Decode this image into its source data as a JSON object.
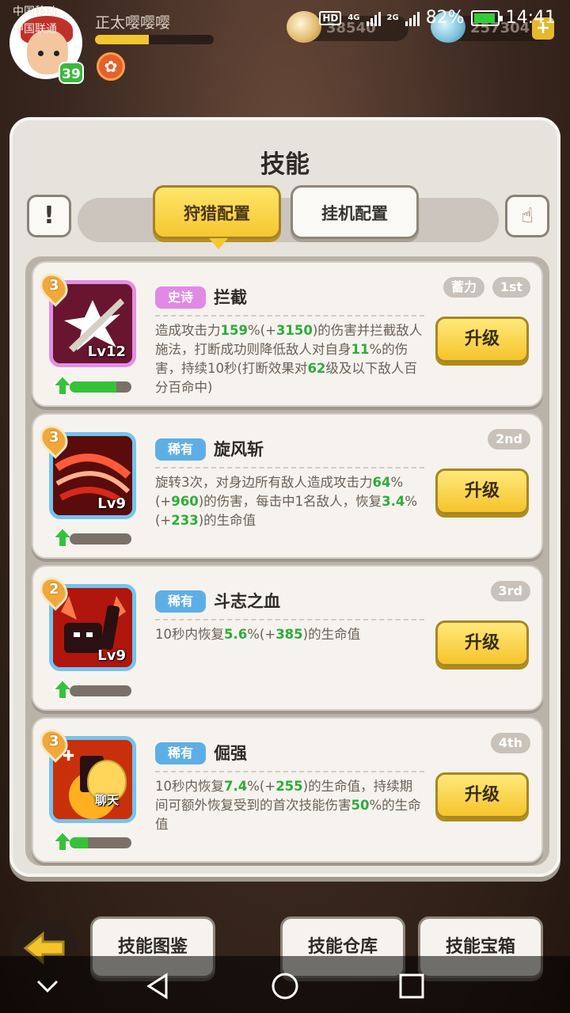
{
  "status_bar": {
    "carrier_1": "中国移动",
    "carrier_2": "中国联通",
    "hd": "HD",
    "net_1": "4G",
    "net_2": "2G",
    "battery": "82%",
    "time": "14:41"
  },
  "player": {
    "name": "正太嘤嘤嘤",
    "level": "39",
    "xp_fraction": 0.45,
    "avatar_icon": "hero-avatar-icon",
    "guild_icon": "guild-emblem-icon"
  },
  "resources": {
    "gold": "38540",
    "stamina": "257304",
    "plus": "+"
  },
  "panel": {
    "title": "技能",
    "info": "!",
    "tabs": [
      "狩猎配置",
      "挂机配置"
    ],
    "active_tab": 0
  },
  "skills": [
    {
      "tier": "3",
      "lv": "Lv12",
      "rarity": "史诗",
      "rarity_type": "epic",
      "name": "拦截",
      "charge": "蓄力",
      "rank": "1st",
      "progress": 0.75,
      "upgrade": "升级",
      "desc": [
        {
          "t": "造成攻击力"
        },
        {
          "t": "159",
          "g": true
        },
        {
          "t": "%(+"
        },
        {
          "t": "3150",
          "g": true
        },
        {
          "t": ")的伤害并拦截敌人施法，打断成功则降低敌人对自身"
        },
        {
          "t": "11",
          "g": true
        },
        {
          "t": "%的伤害，持续10秒(打断效果对"
        },
        {
          "t": "62",
          "g": true
        },
        {
          "t": "级及以下敌人百分百命中)"
        }
      ]
    },
    {
      "tier": "3",
      "lv": "Lv9",
      "rarity": "稀有",
      "rarity_type": "rare",
      "name": "旋风斩",
      "rank": "2nd",
      "progress": 0.0,
      "upgrade": "升级",
      "desc": [
        {
          "t": "旋转3次，对身边所有敌人造成攻击力"
        },
        {
          "t": "64",
          "g": true
        },
        {
          "t": "%(+"
        },
        {
          "t": "960",
          "g": true
        },
        {
          "t": ")的伤害，每击中1名敌人，恢复"
        },
        {
          "t": "3.4",
          "g": true
        },
        {
          "t": "%(+"
        },
        {
          "t": "233",
          "g": true
        },
        {
          "t": ")的生命值"
        }
      ]
    },
    {
      "tier": "2",
      "lv": "Lv9",
      "rarity": "稀有",
      "rarity_type": "rare",
      "name": "斗志之血",
      "rank": "3rd",
      "progress": 0.0,
      "upgrade": "升级",
      "desc": [
        {
          "t": "10秒内恢复"
        },
        {
          "t": "5.6",
          "g": true
        },
        {
          "t": "%(+"
        },
        {
          "t": "385",
          "g": true
        },
        {
          "t": ")的生命值"
        }
      ]
    },
    {
      "tier": "3",
      "lv": "",
      "rarity": "稀有",
      "rarity_type": "rare",
      "name": "倔强",
      "rank": "4th",
      "progress": 0.3,
      "upgrade": "升级",
      "desc": [
        {
          "t": "10秒内恢复"
        },
        {
          "t": "7.4",
          "g": true
        },
        {
          "t": "%(+"
        },
        {
          "t": "255",
          "g": true
        },
        {
          "t": ")的生命值，持续期间可额外恢复受到的首次技能伤害"
        },
        {
          "t": "50",
          "g": true
        },
        {
          "t": "%的生命值"
        }
      ]
    }
  ],
  "chat": {
    "label": "聊天"
  },
  "bottom": {
    "buttons": [
      "技能图鉴",
      "技能仓库",
      "技能宝箱"
    ]
  },
  "colors": {
    "green": "#2eac3a",
    "gold_button": "#f5c42c",
    "epic": "#e08ae6",
    "rare": "#5eaee6"
  }
}
